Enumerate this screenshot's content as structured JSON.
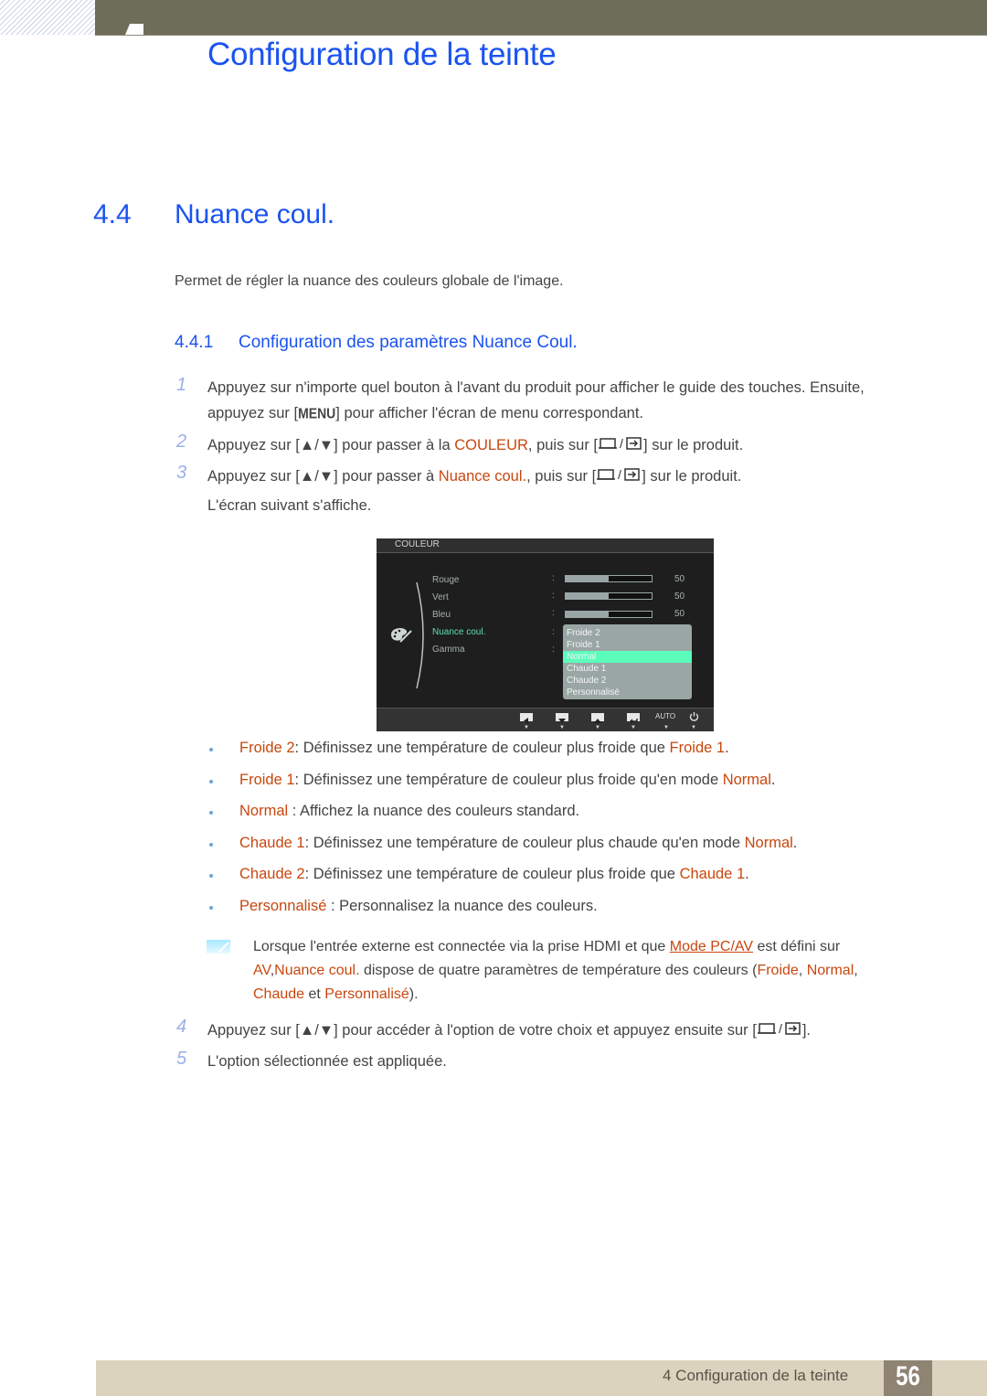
{
  "header": {
    "chapter_title": "Configuration de la teinte"
  },
  "section": {
    "number": "4.4",
    "title": "Nuance coul.",
    "intro": "Permet de régler la nuance des couleurs globale de l'image."
  },
  "subsection": {
    "number": "4.4.1",
    "title": "Configuration des paramètres Nuance Coul."
  },
  "steps": [
    {
      "num": "1",
      "line1": "Appuyez sur n'importe quel bouton à l'avant du produit pour afficher le guide des touches. Ensuite,",
      "line2_pre": "appuyez sur [",
      "line2_key": "MENU",
      "line2_post": "] pour afficher l'écran de menu correspondant."
    },
    {
      "num": "2",
      "pre": "Appuyez sur [",
      "keys": "▲/▼",
      "mid": "] pour passer à la ",
      "hl": "COULEUR",
      "post1": ", puis sur [",
      "post2": "] sur le produit."
    },
    {
      "num": "3",
      "pre": "Appuyez sur [",
      "keys": "▲/▼",
      "mid": "] pour passer à ",
      "hl": "Nuance coul.",
      "post1": ", puis sur [",
      "post2": "] sur le produit.",
      "line2": "L'écran suivant s'affiche."
    },
    {
      "num": "4",
      "pre": "Appuyez sur [",
      "keys": "▲/▼",
      "mid": "] pour accéder à l'option de votre choix et appuyez ensuite sur [",
      "post": "]."
    },
    {
      "num": "5",
      "text": "L'option sélectionnée est appliquée."
    }
  ],
  "osd": {
    "title": "COULEUR",
    "icon": "palette-icon",
    "items": [
      {
        "label": "Rouge",
        "value": "50",
        "level": 0.5
      },
      {
        "label": "Vert",
        "value": "50",
        "level": 0.5
      },
      {
        "label": "Bleu",
        "value": "50",
        "level": 0.5
      },
      {
        "label": "Nuance coul.",
        "active": true
      },
      {
        "label": "Gamma"
      }
    ],
    "dropdown": [
      "Froide 2",
      "Froide 1",
      "Normal",
      "Chaude 1",
      "Chaude 2",
      "Personnalisé"
    ],
    "selected": "Normal",
    "footer_buttons": [
      "left-arrow",
      "down-arrow",
      "up-arrow",
      "enter",
      "AUTO",
      "power"
    ],
    "auto_label": "AUTO",
    "colors": {
      "active": "#5fe0b0",
      "selected_bg": "#5cfcbc"
    }
  },
  "bullets": [
    {
      "term": "Froide 2",
      "sep": ": ",
      "text": "Définissez une température de couleur plus froide que ",
      "ref": "Froide 1",
      "end": "."
    },
    {
      "term": "Froide 1",
      "sep": ": ",
      "text": "Définissez une température de couleur plus froide qu'en mode ",
      "ref": "Normal",
      "end": "."
    },
    {
      "term": "Normal",
      "sep": " : ",
      "text": "Affichez la nuance des couleurs standard.",
      "ref": "",
      "end": ""
    },
    {
      "term": "Chaude 1",
      "sep": ": ",
      "text": "Définissez une température de couleur plus chaude qu'en mode ",
      "ref": "Normal",
      "end": "."
    },
    {
      "term": "Chaude 2",
      "sep": ": ",
      "text": "Définissez une température de couleur plus froide que ",
      "ref": "Chaude 1",
      "end": "."
    },
    {
      "term": "Personnalisé",
      "sep": " : ",
      "text": "Personnalisez la nuance des couleurs.",
      "ref": "",
      "end": ""
    }
  ],
  "note": {
    "l1_pre": "Lorsque l'entrée externe est connectée via la prise HDMI et que ",
    "l1_link": "Mode PC/AV",
    "l1_post": " est défini sur",
    "l2_hl1": "AV",
    "l2_sep": ",",
    "l2_hl2": "Nuance coul.",
    "l2_text": " dispose de quatre paramètres de température des couleurs (",
    "l2_hl3": "Froide",
    "l2_c1": ", ",
    "l2_hl4": "Normal",
    "l2_c2": ",",
    "l3_hl1": "Chaude",
    "l3_mid": " et ",
    "l3_hl2": "Personnalisé",
    "l3_end": ")."
  },
  "footer": {
    "text": "4 Configuration de la teinte",
    "page": "56"
  },
  "colors": {
    "heading_blue": "#1a53f0",
    "highlight_orange": "#c8470f",
    "footer_bg": "#dbd3be",
    "page_box": "#8f8373"
  }
}
